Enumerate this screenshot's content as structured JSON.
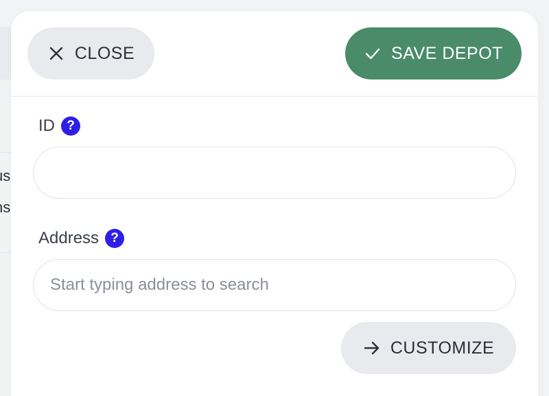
{
  "background": {
    "partial_text_1": "us",
    "partial_text_2": "ns"
  },
  "drawer": {
    "close_button": {
      "label": "CLOSE",
      "icon": "close-icon"
    },
    "save_button": {
      "label": "SAVE DEPOT",
      "icon": "check-icon",
      "color": "#4a8b6a"
    },
    "fields": {
      "id": {
        "label": "ID",
        "help": "?",
        "value": "",
        "placeholder": ""
      },
      "address": {
        "label": "Address",
        "help": "?",
        "value": "",
        "placeholder": "Start typing address to search"
      }
    },
    "customize_button": {
      "label": "CUSTOMIZE",
      "icon": "arrow-right-icon"
    },
    "help_color": "#2f1fe6"
  }
}
